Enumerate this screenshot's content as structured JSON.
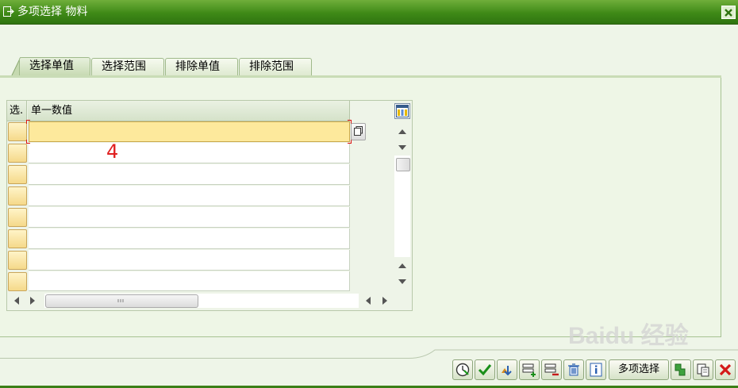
{
  "window": {
    "title": "多项选择 物料"
  },
  "tabs": [
    {
      "label": "选择单值",
      "active": true
    },
    {
      "label": "选择范围",
      "active": false
    },
    {
      "label": "排除单值",
      "active": false
    },
    {
      "label": "排除范围",
      "active": false
    }
  ],
  "table": {
    "columns": [
      "选.",
      "单一数值"
    ],
    "rows": [
      "",
      "",
      "",
      "",
      "",
      "",
      "",
      ""
    ],
    "focused_row": 0
  },
  "annotation": "4",
  "toolbar": {
    "buttons": [
      "execute-icon",
      "check-icon",
      "import-icon",
      "add-row-icon",
      "delete-row-icon",
      "delete-all-icon",
      "info-icon"
    ],
    "multi_select_label": "多项选择",
    "trailing_buttons": [
      "copy-icon",
      "paste-icon",
      "cancel-icon"
    ]
  },
  "watermark": "Baidu 经验",
  "colors": {
    "titlebar": "#3f8a17",
    "focused_cell": "#fde99c",
    "selector": "#f5d98a",
    "annotation": "#e02020"
  }
}
